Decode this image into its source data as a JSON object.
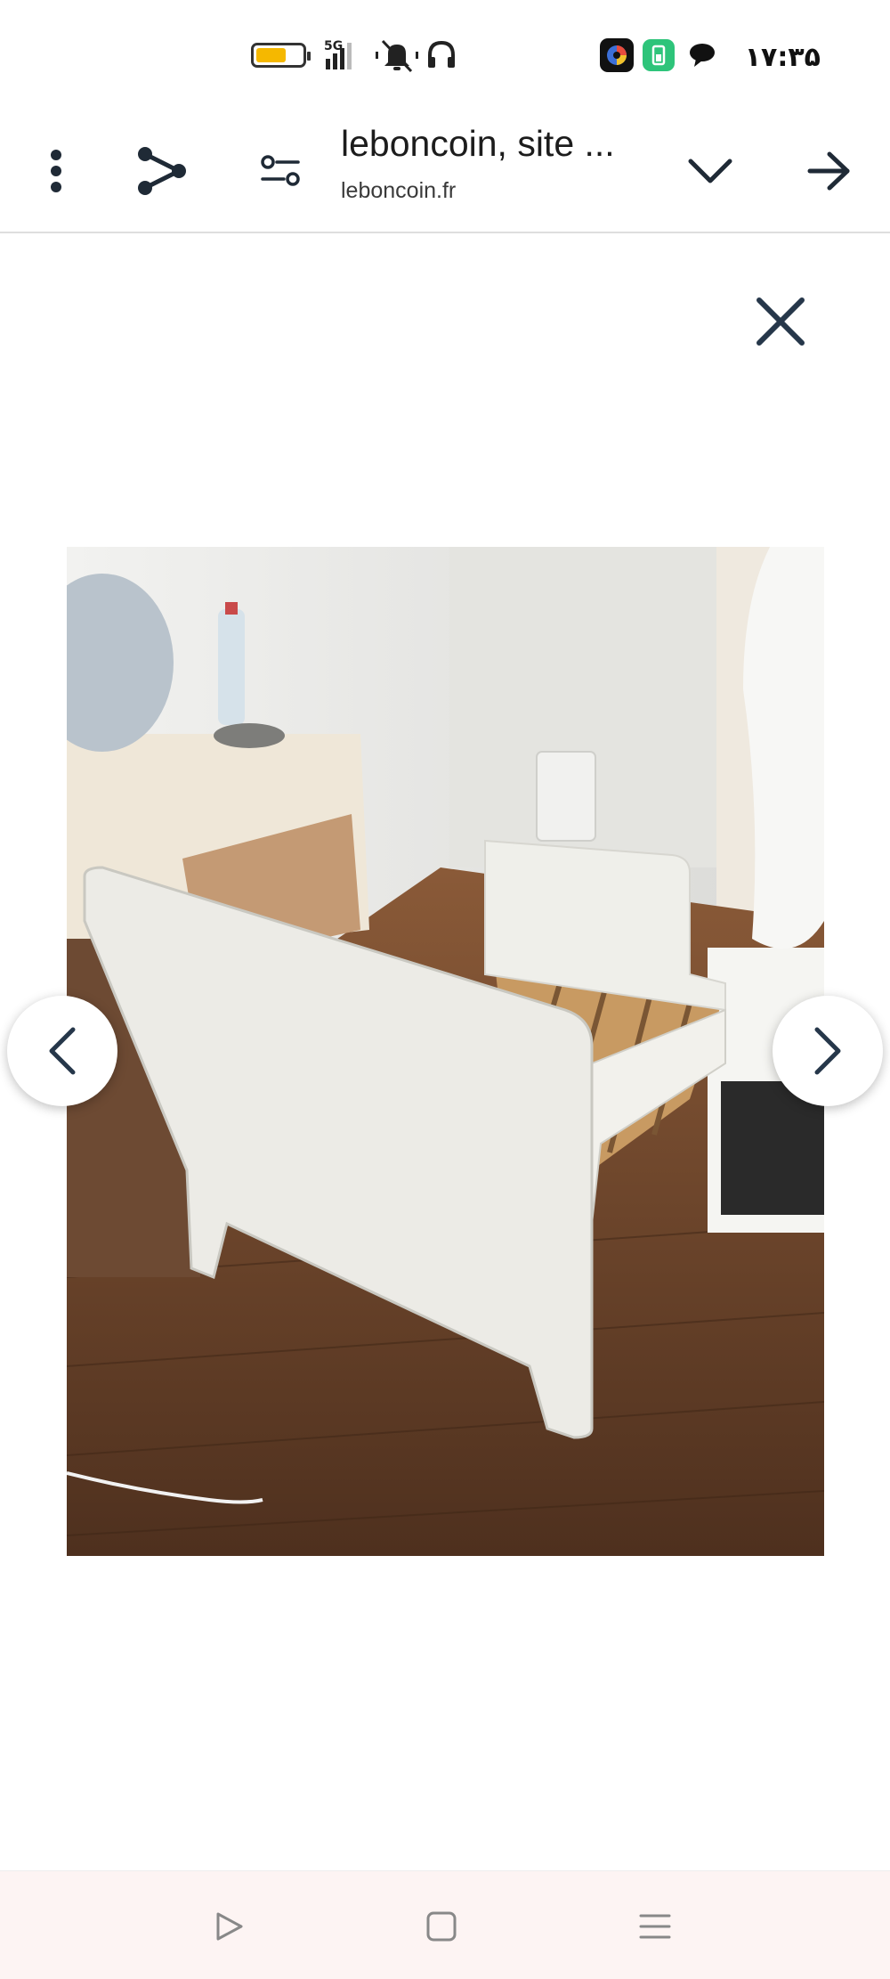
{
  "status_bar": {
    "battery_level": 0.65,
    "network_label": "5G",
    "icons": [
      "battery-icon",
      "signal-5g-icon",
      "mute-icon",
      "headphones-icon",
      "app-icon-camera",
      "app-icon-green",
      "chat-bubble-icon"
    ],
    "time": "۱۷:۳۵"
  },
  "toolbar": {
    "title": "leboncoin, site ...",
    "domain": "leboncoin.fr",
    "icons": [
      "more-vert-icon",
      "share-icon",
      "tune-icon",
      "chevron-down-icon",
      "arrow-right-icon"
    ]
  },
  "viewer": {
    "close_icon": "close-icon",
    "prev_icon": "chevron-left-icon",
    "next_icon": "chevron-right-icon"
  },
  "bottom_nav": {
    "icons": [
      "back-icon",
      "home-icon",
      "recents-icon"
    ]
  },
  "colors": {
    "battery": "#f5b800",
    "floor": "#6a4630",
    "bed": "#ecebe6",
    "wall": "#e9e9e6",
    "nav_background": "#fdf4f3",
    "icon_dark": "#2b3a4a"
  }
}
